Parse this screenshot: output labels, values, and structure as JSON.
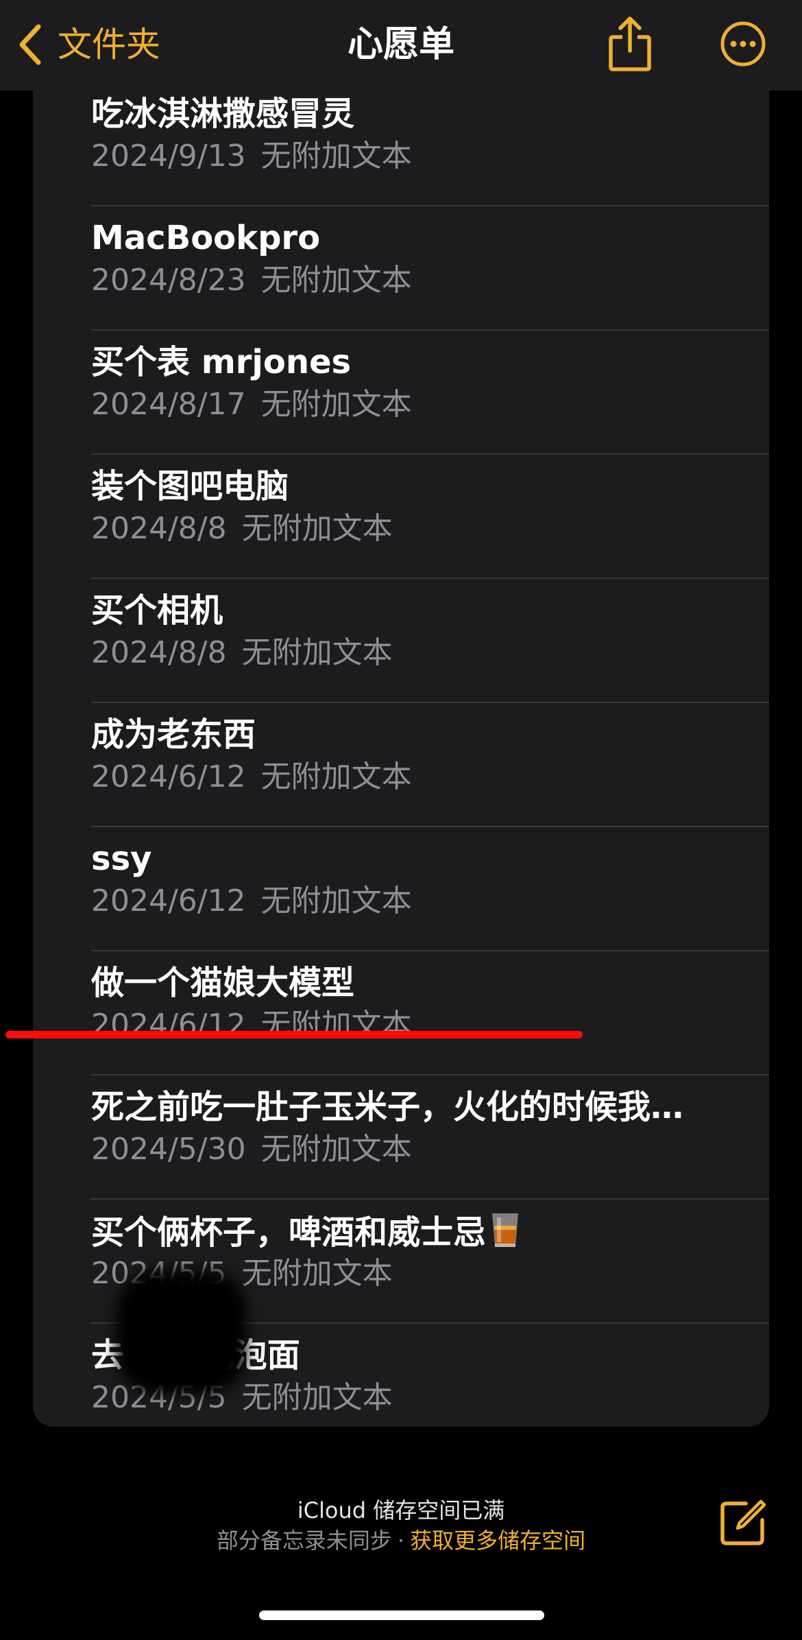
{
  "colors": {
    "accent": "#f0b030",
    "background": "#000000",
    "card": "#1c1c1e",
    "secondary_text": "#8e8e93",
    "annotation": "#ff0a0a"
  },
  "nav": {
    "back_label": "文件夹",
    "back_icon": "chevron-left-icon",
    "title": "心愿单",
    "share_icon": "share-icon",
    "more_icon": "ellipsis-circle-icon"
  },
  "notes": [
    {
      "title": "吃冰淇淋撒感冒灵",
      "date": "2024/9/13",
      "subtitle": "无附加文本"
    },
    {
      "title": "MacBookpro",
      "date": "2024/8/23",
      "subtitle": "无附加文本"
    },
    {
      "title": "买个表 mrjones",
      "date": "2024/8/17",
      "subtitle": "无附加文本"
    },
    {
      "title": "装个图吧电脑",
      "date": "2024/8/8",
      "subtitle": "无附加文本"
    },
    {
      "title": "买个相机",
      "date": "2024/8/8",
      "subtitle": "无附加文本"
    },
    {
      "title": "成为老东西",
      "date": "2024/6/12",
      "subtitle": "无附加文本"
    },
    {
      "title": "ssy",
      "date": "2024/6/12",
      "subtitle": "无附加文本"
    },
    {
      "title": "做一个猫娘大模型",
      "date": "2024/6/12",
      "subtitle": "无附加文本"
    },
    {
      "title": "死之前吃一肚子玉米子，火化的时候我…",
      "date": "2024/5/30",
      "subtitle": "无附加文本"
    },
    {
      "title": "买个俩杯子，啤酒和威士忌",
      "date": "2024/5/5",
      "subtitle": "无附加文本",
      "emoji": "whisky-glass-icon"
    },
    {
      "title": "去 床上吃泡面",
      "date": "2024/5/5",
      "subtitle": "无附加文本"
    }
  ],
  "footer": {
    "status_line": "iCloud 储存空间已满",
    "sync_text": "部分备忘录未同步",
    "separator": "·",
    "link_text": "获取更多储存空间",
    "compose_icon": "compose-icon"
  }
}
